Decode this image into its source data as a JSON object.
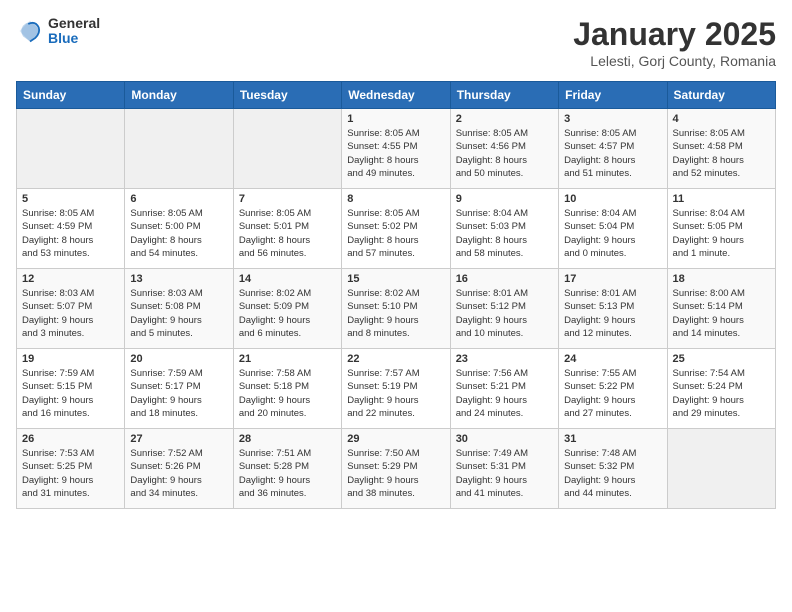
{
  "logo": {
    "general": "General",
    "blue": "Blue"
  },
  "header": {
    "title": "January 2025",
    "subtitle": "Lelesti, Gorj County, Romania"
  },
  "days_of_week": [
    "Sunday",
    "Monday",
    "Tuesday",
    "Wednesday",
    "Thursday",
    "Friday",
    "Saturday"
  ],
  "weeks": [
    [
      {
        "day": "",
        "info": ""
      },
      {
        "day": "",
        "info": ""
      },
      {
        "day": "",
        "info": ""
      },
      {
        "day": "1",
        "info": "Sunrise: 8:05 AM\nSunset: 4:55 PM\nDaylight: 8 hours\nand 49 minutes."
      },
      {
        "day": "2",
        "info": "Sunrise: 8:05 AM\nSunset: 4:56 PM\nDaylight: 8 hours\nand 50 minutes."
      },
      {
        "day": "3",
        "info": "Sunrise: 8:05 AM\nSunset: 4:57 PM\nDaylight: 8 hours\nand 51 minutes."
      },
      {
        "day": "4",
        "info": "Sunrise: 8:05 AM\nSunset: 4:58 PM\nDaylight: 8 hours\nand 52 minutes."
      }
    ],
    [
      {
        "day": "5",
        "info": "Sunrise: 8:05 AM\nSunset: 4:59 PM\nDaylight: 8 hours\nand 53 minutes."
      },
      {
        "day": "6",
        "info": "Sunrise: 8:05 AM\nSunset: 5:00 PM\nDaylight: 8 hours\nand 54 minutes."
      },
      {
        "day": "7",
        "info": "Sunrise: 8:05 AM\nSunset: 5:01 PM\nDaylight: 8 hours\nand 56 minutes."
      },
      {
        "day": "8",
        "info": "Sunrise: 8:05 AM\nSunset: 5:02 PM\nDaylight: 8 hours\nand 57 minutes."
      },
      {
        "day": "9",
        "info": "Sunrise: 8:04 AM\nSunset: 5:03 PM\nDaylight: 8 hours\nand 58 minutes."
      },
      {
        "day": "10",
        "info": "Sunrise: 8:04 AM\nSunset: 5:04 PM\nDaylight: 9 hours\nand 0 minutes."
      },
      {
        "day": "11",
        "info": "Sunrise: 8:04 AM\nSunset: 5:05 PM\nDaylight: 9 hours\nand 1 minute."
      }
    ],
    [
      {
        "day": "12",
        "info": "Sunrise: 8:03 AM\nSunset: 5:07 PM\nDaylight: 9 hours\nand 3 minutes."
      },
      {
        "day": "13",
        "info": "Sunrise: 8:03 AM\nSunset: 5:08 PM\nDaylight: 9 hours\nand 5 minutes."
      },
      {
        "day": "14",
        "info": "Sunrise: 8:02 AM\nSunset: 5:09 PM\nDaylight: 9 hours\nand 6 minutes."
      },
      {
        "day": "15",
        "info": "Sunrise: 8:02 AM\nSunset: 5:10 PM\nDaylight: 9 hours\nand 8 minutes."
      },
      {
        "day": "16",
        "info": "Sunrise: 8:01 AM\nSunset: 5:12 PM\nDaylight: 9 hours\nand 10 minutes."
      },
      {
        "day": "17",
        "info": "Sunrise: 8:01 AM\nSunset: 5:13 PM\nDaylight: 9 hours\nand 12 minutes."
      },
      {
        "day": "18",
        "info": "Sunrise: 8:00 AM\nSunset: 5:14 PM\nDaylight: 9 hours\nand 14 minutes."
      }
    ],
    [
      {
        "day": "19",
        "info": "Sunrise: 7:59 AM\nSunset: 5:15 PM\nDaylight: 9 hours\nand 16 minutes."
      },
      {
        "day": "20",
        "info": "Sunrise: 7:59 AM\nSunset: 5:17 PM\nDaylight: 9 hours\nand 18 minutes."
      },
      {
        "day": "21",
        "info": "Sunrise: 7:58 AM\nSunset: 5:18 PM\nDaylight: 9 hours\nand 20 minutes."
      },
      {
        "day": "22",
        "info": "Sunrise: 7:57 AM\nSunset: 5:19 PM\nDaylight: 9 hours\nand 22 minutes."
      },
      {
        "day": "23",
        "info": "Sunrise: 7:56 AM\nSunset: 5:21 PM\nDaylight: 9 hours\nand 24 minutes."
      },
      {
        "day": "24",
        "info": "Sunrise: 7:55 AM\nSunset: 5:22 PM\nDaylight: 9 hours\nand 27 minutes."
      },
      {
        "day": "25",
        "info": "Sunrise: 7:54 AM\nSunset: 5:24 PM\nDaylight: 9 hours\nand 29 minutes."
      }
    ],
    [
      {
        "day": "26",
        "info": "Sunrise: 7:53 AM\nSunset: 5:25 PM\nDaylight: 9 hours\nand 31 minutes."
      },
      {
        "day": "27",
        "info": "Sunrise: 7:52 AM\nSunset: 5:26 PM\nDaylight: 9 hours\nand 34 minutes."
      },
      {
        "day": "28",
        "info": "Sunrise: 7:51 AM\nSunset: 5:28 PM\nDaylight: 9 hours\nand 36 minutes."
      },
      {
        "day": "29",
        "info": "Sunrise: 7:50 AM\nSunset: 5:29 PM\nDaylight: 9 hours\nand 38 minutes."
      },
      {
        "day": "30",
        "info": "Sunrise: 7:49 AM\nSunset: 5:31 PM\nDaylight: 9 hours\nand 41 minutes."
      },
      {
        "day": "31",
        "info": "Sunrise: 7:48 AM\nSunset: 5:32 PM\nDaylight: 9 hours\nand 44 minutes."
      },
      {
        "day": "",
        "info": ""
      }
    ]
  ]
}
